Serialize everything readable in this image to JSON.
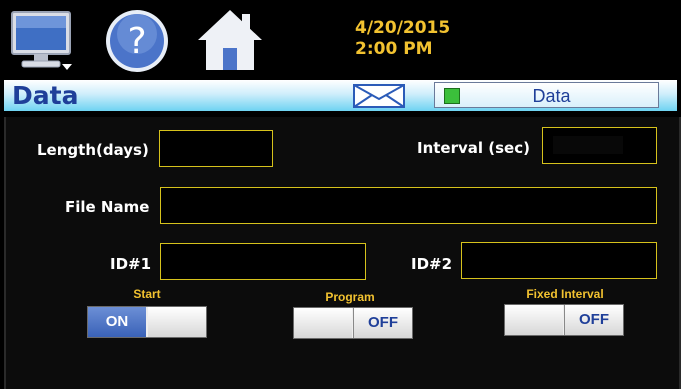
{
  "header": {
    "date": "4/20/2015",
    "time": "2:00 PM",
    "icons": [
      "monitor-icon",
      "help-icon",
      "home-icon"
    ]
  },
  "titlebar": {
    "title": "Data",
    "mail_icon": "envelope-icon",
    "data_button_label": "Data"
  },
  "form": {
    "length_label": "Length(days)",
    "length_value": "",
    "interval_label": "Interval (sec)",
    "interval_value": "",
    "filename_label": "File Name",
    "filename_value": "",
    "id1_label": "ID#1",
    "id1_value": "",
    "id2_label": "ID#2",
    "id2_value": ""
  },
  "toggles": [
    {
      "label": "Start",
      "state": "ON"
    },
    {
      "label": "Program",
      "state": "OFF"
    },
    {
      "label": "Fixed Interval",
      "state": "OFF"
    }
  ],
  "colors": {
    "accent_yellow": "#f2c230",
    "field_border": "#d6c21c",
    "title_blue": "#1f3f99",
    "indicator_green": "#3bbf3b"
  }
}
